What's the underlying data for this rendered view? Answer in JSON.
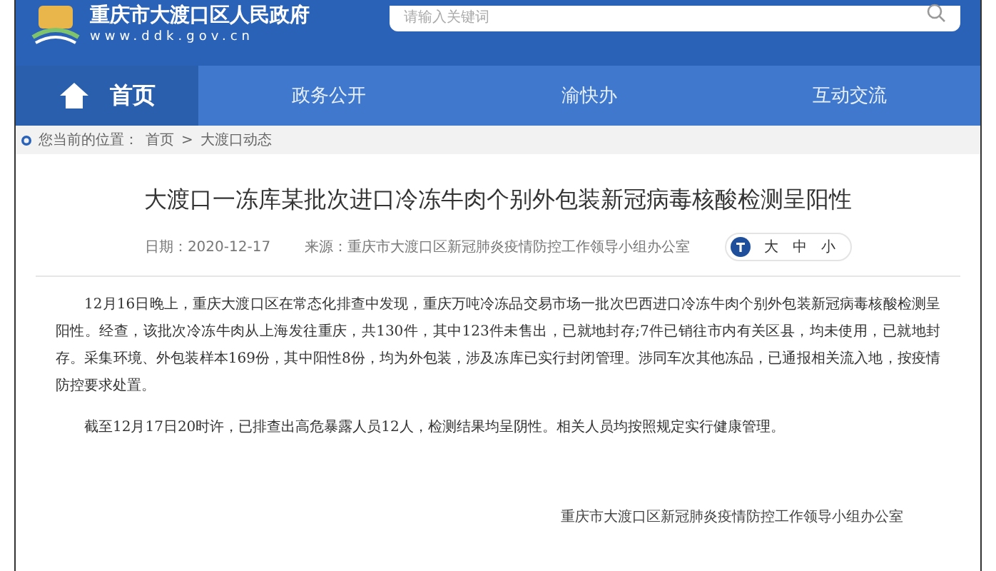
{
  "header": {
    "site_title": "重庆市大渡口区人民政府",
    "url": "www.ddk.gov.cn",
    "search": {
      "placeholder": "请输入关键词"
    }
  },
  "nav": [
    {
      "label": "首页",
      "selected": true
    },
    {
      "label": "政务公开",
      "selected": false
    },
    {
      "label": "渝快办",
      "selected": false
    },
    {
      "label": "互动交流",
      "selected": false
    }
  ],
  "breadcrumb": {
    "label": "您当前的位置：",
    "items": [
      "首页",
      "大渡口动态"
    ],
    "separator": ">"
  },
  "article": {
    "title": "大渡口一冻库某批次进口冷冻牛肉个别外包装新冠病毒核酸检测呈阳性",
    "date": "日期：2020-12-17",
    "source": "来源：重庆市大渡口区新冠肺炎疫情防控工作领导小组办公室",
    "font_sizes": [
      {
        "label": "大",
        "selected": false
      },
      {
        "label": "中",
        "selected": false
      },
      {
        "label": "小",
        "selected": false
      }
    ],
    "paragraphs": [
      "12月16日晚上，重庆大渡口区在常态化排查中发现，重庆万吨冷冻品交易市场一批次巴西进口冷冻牛肉个别外包装新冠病毒核酸检测呈阳性。经查，该批次冷冻牛肉从上海发往重庆，共130件，其中123件未售出，已就地封存;7件已销往市内有关区县，均未使用，已就地封存。采集环境、外包装样本169份，其中阳性8份，均为外包装，涉及冻库已实行封闭管理。涉同车次其他冻品，已通报相关流入地，按疫情防控要求处置。",
      "截至12月17日20时许，已排查出高危暴露人员12人，检测结果均呈阴性。相关人员均按照规定实行健康管理。"
    ],
    "signature": "重庆市大渡口区新冠肺炎疫情防控工作领导小组办公室"
  }
}
